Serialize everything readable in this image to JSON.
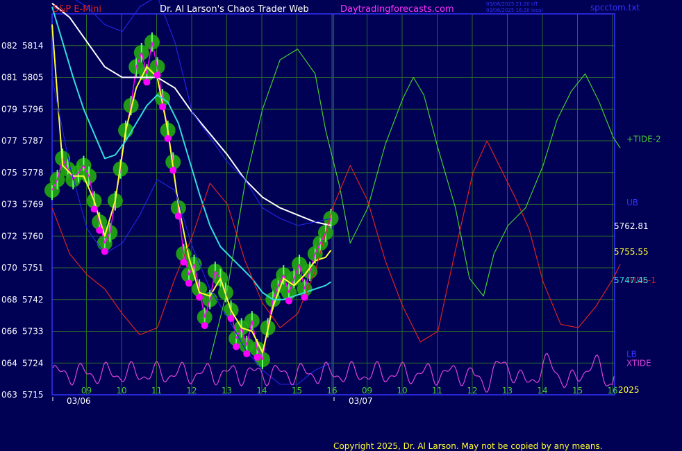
{
  "header": {
    "symbol": "S&P E-Mini",
    "title": "Dr. Al Larson's Chaos Trader Web",
    "site": "Daytradingforecasts.com",
    "timestamp_1": "03/06/2025 21:20 UT",
    "timestamp_2": "03/06/2025 16:20 local",
    "file": "spcctom.txt"
  },
  "footer": {
    "copyright": "Copyright 2025, Dr. Al Larson. May not be copied by any means.",
    "year": "2025"
  },
  "colors": {
    "background": "#000055",
    "plot_border": "#3333ff",
    "grid": "#2a6a2a",
    "price": "#ff00ff",
    "moving_avg_fast": "#ffff33",
    "moving_avg_mid": "#33dddd",
    "moving_avg_slow": "#ffffff",
    "bands": "#2222dd",
    "tide_plus2": "#44cc33",
    "tide_minus1": "#dd2222",
    "xtide": "#dd44dd",
    "bubble": "#22aa11"
  },
  "chart_data": {
    "type": "line",
    "y_ticks": [
      {
        "count": "063",
        "price": "5715"
      },
      {
        "count": "064",
        "price": "5724"
      },
      {
        "count": "066",
        "price": "5733"
      },
      {
        "count": "068",
        "price": "5742"
      },
      {
        "count": "070",
        "price": "5751"
      },
      {
        "count": "072",
        "price": "5760"
      },
      {
        "count": "073",
        "price": "5769"
      },
      {
        "count": "075",
        "price": "5778"
      },
      {
        "count": "077",
        "price": "5787"
      },
      {
        "count": "079",
        "price": "5796"
      },
      {
        "count": "081",
        "price": "5805"
      },
      {
        "count": "082",
        "price": "5814"
      }
    ],
    "ylim": [
      5715,
      5823
    ],
    "x_ticks": [
      "09",
      "10",
      "11",
      "12",
      "13",
      "14",
      "15",
      "16",
      "09",
      "10",
      "11",
      "12",
      "13",
      "14",
      "15",
      "16"
    ],
    "dates": [
      "03/06",
      "03/07"
    ],
    "grid": true,
    "right_labels": [
      {
        "text": "+TIDE-2",
        "color": "#44cc33",
        "y": 5787.5
      },
      {
        "text": "UB",
        "color": "#3333ff",
        "y": 5769.5
      },
      {
        "text": "5762.81",
        "color": "#ffffff",
        "y": 5762.81
      },
      {
        "text": "5755.55",
        "color": "#ffff33",
        "y": 5755.55
      },
      {
        "text": "-TIDE-1",
        "color": "#dd2222",
        "y": 5747.45
      },
      {
        "text": "5747.45",
        "color": "#33dddd",
        "y": 5747.45
      },
      {
        "text": "LB",
        "color": "#3333ff",
        "y": 5726.5
      },
      {
        "text": "XTIDE",
        "color": "#dd44dd",
        "y": 5724
      }
    ],
    "series": [
      {
        "key": "price",
        "x": [
          0,
          0.15,
          0.3,
          0.45,
          0.6,
          0.75,
          0.9,
          1.05,
          1.2,
          1.35,
          1.5,
          1.65,
          1.8,
          1.95,
          2.1,
          2.25,
          2.4,
          2.55,
          2.7,
          2.85,
          3.0,
          3.15,
          3.3,
          3.45,
          3.6,
          3.75,
          3.9,
          4.05,
          4.2,
          4.35,
          4.5,
          4.65,
          4.8,
          4.95,
          5.1,
          5.25,
          5.4,
          5.55,
          5.7,
          5.85,
          6.0,
          6.15,
          6.3,
          6.45,
          6.6,
          6.75,
          6.9,
          7.05,
          7.2,
          7.35,
          7.5,
          7.65,
          7.8,
          7.95
        ],
        "values": [
          5773,
          5776,
          5782,
          5779,
          5776,
          5778,
          5780,
          5777,
          5770,
          5764,
          5758,
          5761,
          5770,
          5779,
          5790,
          5797,
          5808,
          5812,
          5806,
          5815,
          5808,
          5799,
          5790,
          5781,
          5768,
          5755,
          5749,
          5752,
          5745,
          5737,
          5742,
          5750,
          5748,
          5744,
          5739,
          5731,
          5734,
          5729,
          5736,
          5728,
          5725,
          5734,
          5742,
          5746,
          5749,
          5744,
          5748,
          5752,
          5745,
          5750,
          5755,
          5758,
          5761,
          5765
        ]
      },
      {
        "key": "moving_avg_fast",
        "x": [
          0,
          0.3,
          0.6,
          0.9,
          1.2,
          1.5,
          1.8,
          2.1,
          2.4,
          2.7,
          3.0,
          3.3,
          3.6,
          3.9,
          4.2,
          4.5,
          4.8,
          5.1,
          5.4,
          5.7,
          6.0,
          6.3,
          6.6,
          6.9,
          7.2,
          7.5,
          7.8,
          7.95
        ],
        "values": [
          5820,
          5780,
          5777,
          5777,
          5770,
          5760,
          5770,
          5790,
          5802,
          5808,
          5805,
          5790,
          5769,
          5754,
          5744,
          5743,
          5748,
          5739,
          5734,
          5733,
          5727,
          5740,
          5748,
          5746,
          5749,
          5753,
          5754,
          5756
        ]
      },
      {
        "key": "moving_avg_mid",
        "x": [
          0,
          0.3,
          0.6,
          0.9,
          1.2,
          1.5,
          1.8,
          2.1,
          2.4,
          2.7,
          3.0,
          3.3,
          3.6,
          3.9,
          4.2,
          4.5,
          4.8,
          5.1,
          5.4,
          5.7,
          6.0,
          6.3,
          6.6,
          6.9,
          7.2,
          7.5,
          7.8,
          7.95
        ],
        "values": [
          5825,
          5815,
          5805,
          5796,
          5789,
          5782,
          5783,
          5787,
          5792,
          5797,
          5800,
          5798,
          5792,
          5782,
          5772,
          5763,
          5757,
          5754,
          5751,
          5748,
          5744,
          5742,
          5742,
          5743,
          5744,
          5745,
          5746,
          5747
        ]
      },
      {
        "key": "moving_avg_slow",
        "x": [
          0,
          0.5,
          1.0,
          1.5,
          2.0,
          2.5,
          3.0,
          3.5,
          4.0,
          4.5,
          5.0,
          5.5,
          6.0,
          6.5,
          7.0,
          7.5,
          7.95
        ],
        "values": [
          5826,
          5822,
          5815,
          5808,
          5805,
          5805,
          5805,
          5802,
          5795,
          5789,
          5783,
          5776,
          5771,
          5768,
          5766,
          5764,
          5763
        ]
      },
      {
        "key": "bands_upper",
        "x": [
          0,
          0.5,
          1.0,
          1.5,
          2.0,
          2.5,
          3.0,
          3.5,
          4.0,
          4.5,
          5.0,
          5.5,
          6.0,
          6.5,
          7.0,
          7.5,
          7.95
        ],
        "values": [
          5830,
          5828,
          5825,
          5820,
          5818,
          5825,
          5828,
          5815,
          5795,
          5788,
          5781,
          5776,
          5768,
          5765,
          5763,
          5764,
          5765
        ]
      },
      {
        "key": "bands_lower",
        "x": [
          0,
          0.5,
          1.0,
          1.5,
          2.0,
          2.5,
          3.0,
          3.5,
          4.0,
          4.5,
          5.0,
          5.5,
          6.0,
          6.5,
          7.0,
          7.5,
          7.95
        ],
        "values": [
          5805,
          5780,
          5762,
          5755,
          5758,
          5766,
          5776,
          5773,
          5757,
          5745,
          5737,
          5728,
          5722,
          5718,
          5718,
          5722,
          5724
        ]
      },
      {
        "key": "tide_plus2",
        "x": [
          4.5,
          5.0,
          5.5,
          6.0,
          6.5,
          7.0,
          7.5,
          7.8,
          8.2,
          8.5,
          9.0,
          9.5,
          10.0,
          10.3,
          10.6,
          11.0,
          11.5,
          11.9,
          12.3,
          12.6,
          13.0,
          13.5,
          14.0,
          14.4,
          14.8,
          15.2,
          15.6,
          16.0,
          16.2
        ],
        "values": [
          5725,
          5745,
          5775,
          5796,
          5810,
          5813,
          5806,
          5790,
          5774,
          5758,
          5768,
          5786,
          5799,
          5805,
          5800,
          5785,
          5768,
          5748,
          5743,
          5755,
          5763,
          5768,
          5780,
          5793,
          5801,
          5806,
          5798,
          5788,
          5785
        ],
        "note_plot": "rendered"
      },
      {
        "key": "tide_minus1",
        "x": [
          0,
          0.5,
          1.0,
          1.5,
          2.0,
          2.5,
          3.0,
          3.5,
          4.0,
          4.5,
          5.0,
          5.5,
          6.0,
          6.5,
          7.0,
          7.5,
          8.0,
          8.5,
          9.0,
          9.5,
          10.0,
          10.5,
          11.0,
          11.5,
          12.0,
          12.4,
          12.8,
          13.2,
          13.6,
          14.0,
          14.5,
          15.0,
          15.5,
          16.0,
          16.2
        ],
        "values": [
          5768,
          5755,
          5749,
          5745,
          5738,
          5732,
          5734,
          5748,
          5760,
          5775,
          5769,
          5753,
          5741,
          5734,
          5738,
          5750,
          5768,
          5780,
          5770,
          5753,
          5740,
          5730,
          5733,
          5756,
          5778,
          5787,
          5779,
          5771,
          5762,
          5747,
          5735,
          5734,
          5740,
          5748,
          5752
        ]
      }
    ],
    "xtide": "rendered"
  }
}
